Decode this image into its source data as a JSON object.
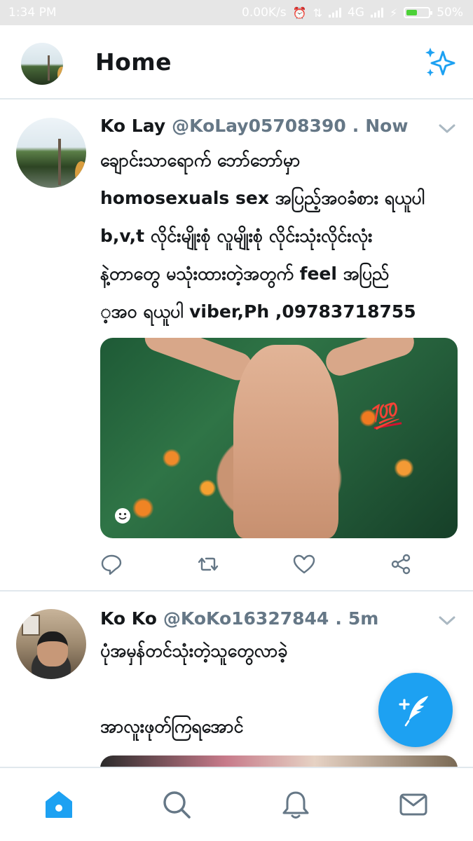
{
  "status_bar": {
    "time": "1:34 PM",
    "network_speed": "0.00K/s",
    "network_type": "4G",
    "battery_percent": "50%",
    "battery_level": 0.5
  },
  "header": {
    "title": "Home",
    "profile_avatar": "profile-avatar",
    "sparkle_icon": "sparkle-icon"
  },
  "tweets": [
    {
      "name": "Ko Lay",
      "handle": "@KoLay05708390",
      "separator": ".",
      "time": "Now",
      "text_lines": [
        "ချောင်းသာရောက် ဘော်ဘော်မှာ",
        "homosexuals sex အပြည့်အဝခံစား ရယူပါ",
        "b,v,t လိုင်းမျိုးစုံ လူမျိုးစုံ လိုင်းသုံးလိုင်းလုံး",
        "နဲ့တာတွေ မသုံးထားတဲ့အတွက် feel အပြည်",
        "့အဝ ရယူပါ viber,Ph ,09783718755"
      ],
      "media_label": "💯",
      "actions": [
        "reply-icon",
        "retweet-icon",
        "like-icon",
        "share-icon"
      ]
    },
    {
      "name": "Ko Ko",
      "handle": "@KoKo16327844",
      "separator": ".",
      "time": "5m",
      "text_lines": [
        "ပုံအမှန်တင်သုံးတဲ့သူတွေလာခဲ့",
        "",
        "အာလူးဖုတ်ကြရအောင်"
      ]
    }
  ],
  "compose_button": "compose-tweet-icon",
  "bottom_nav": [
    "home-icon",
    "search-icon",
    "notifications-icon",
    "messages-icon"
  ],
  "colors": {
    "accent": "#1da1f2",
    "text": "#14171a",
    "secondary_text": "#657786",
    "divider": "#e1e8ed",
    "status_bar_bg": "#e6e6e6",
    "hundred_emoji": "#d3122f"
  }
}
